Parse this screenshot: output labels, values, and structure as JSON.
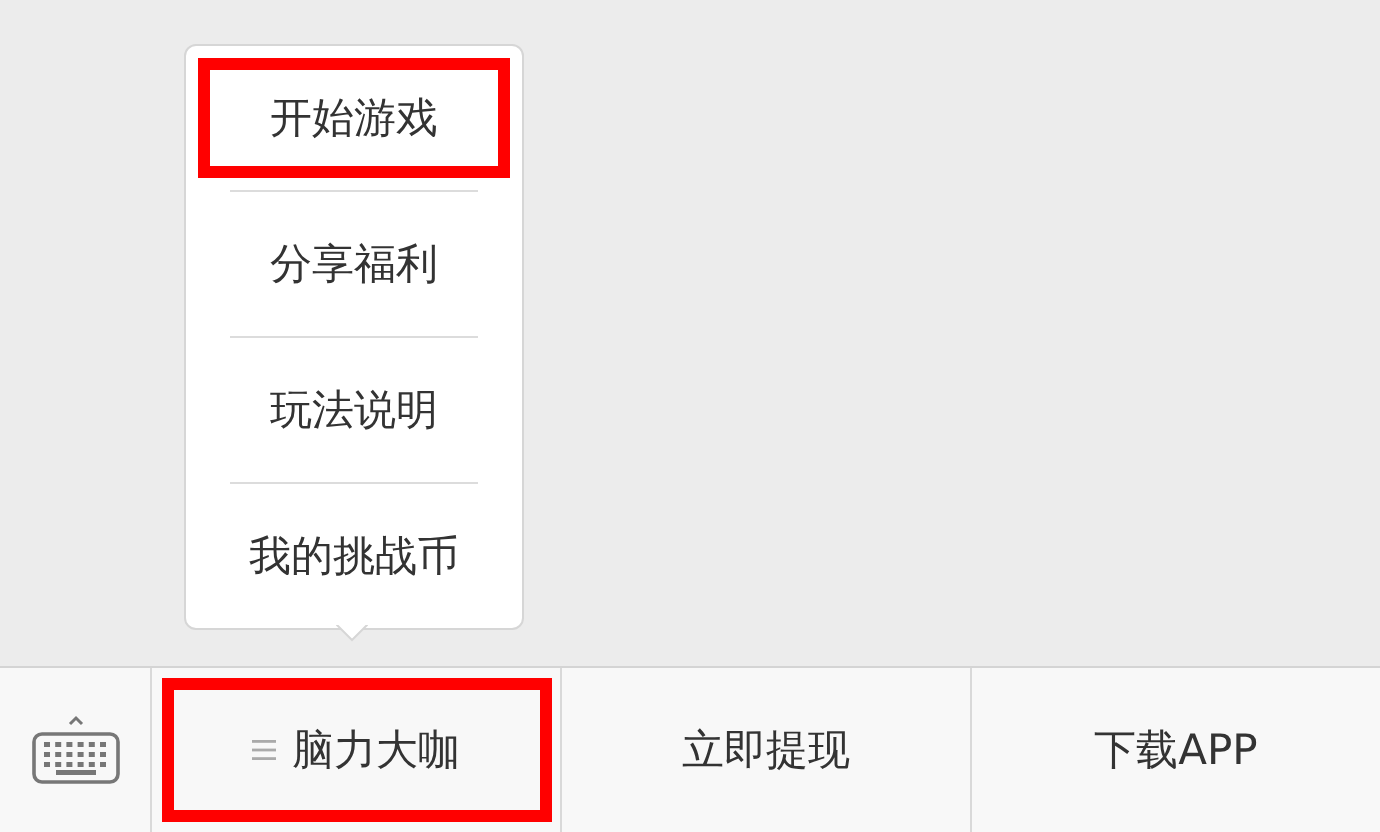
{
  "submenu": [
    {
      "label": "开始游戏",
      "highlighted": true
    },
    {
      "label": "分享福利",
      "highlighted": false
    },
    {
      "label": "玩法说明",
      "highlighted": false
    },
    {
      "label": "我的挑战币",
      "highlighted": false
    }
  ],
  "menu_bar": [
    {
      "label": "脑力大咖",
      "has_submenu": true,
      "highlighted": true
    },
    {
      "label": "立即提现",
      "has_submenu": false,
      "highlighted": false
    },
    {
      "label": "下载APP",
      "has_submenu": false,
      "highlighted": false
    }
  ]
}
